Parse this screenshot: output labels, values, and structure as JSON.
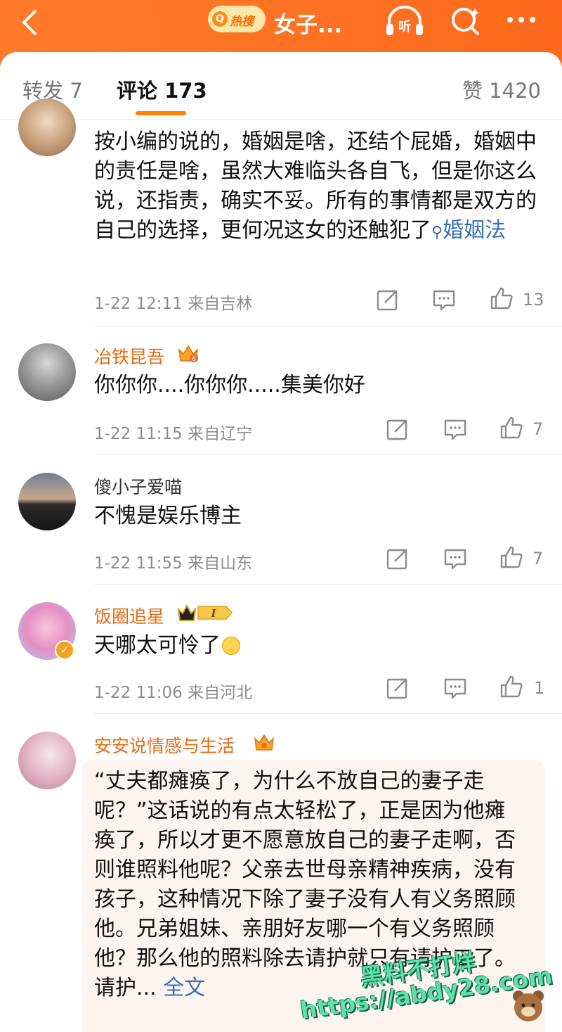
{
  "header": {
    "hot_search_label": "热搜",
    "topic_title": "女子...",
    "listen_label": "听",
    "brand_color": "#ff7a2a"
  },
  "tabs": {
    "repost": "转发 7",
    "comments": "评论 173",
    "likes": "赞 1420",
    "active": "comments",
    "accent": "#ff8200"
  },
  "comments": [
    {
      "username": "",
      "text_before_tag": "按小编的说的，婚姻是啥，还结个屁婚，婚姻中的责任是啥，虽然大难临头各自飞，但是你这么说，还指责，确实不妥。所有的事情都是双方的自己的选择，更何况这女的还触犯了",
      "hashtag": "婚姻法",
      "time": "1-22 12:11",
      "location": "来自吉林",
      "likes": "13"
    },
    {
      "username": "冶铁昆吾",
      "text": "你你你....你你你.....集美你好",
      "time": "1-22 11:15",
      "location": "来自辽宁",
      "likes": "7"
    },
    {
      "username": "傻小子爱喵",
      "text": "不愧是娱乐博主",
      "time": "1-22 11:55",
      "location": "来自山东",
      "likes": "7"
    },
    {
      "username": "饭圈追星",
      "text": "天哪太可怜了",
      "badge_level": "I",
      "time": "1-22 11:06",
      "location": "来自河北",
      "likes": "1"
    },
    {
      "username": "安安说情感与生活",
      "text": "“丈夫都瘫痪了，为什么不放自己的妻子走呢？”这话说的有点太轻松了，正是因为他瘫痪了，所以才更不愿意放自己的妻子走啊，否则谁照料他呢？父亲去世母亲精神疾病，没有孩子，这种情况下除了妻子没有人有义务照顾他。兄弟姐妹、亲朋好友哪一个有义务照顾他？那么他的照料除去请护就只有请护工了。请护...",
      "full_text_label": "全文"
    }
  ],
  "watermark": {
    "line1": "黑料不打烊",
    "line2": "https://abdy28.com"
  }
}
